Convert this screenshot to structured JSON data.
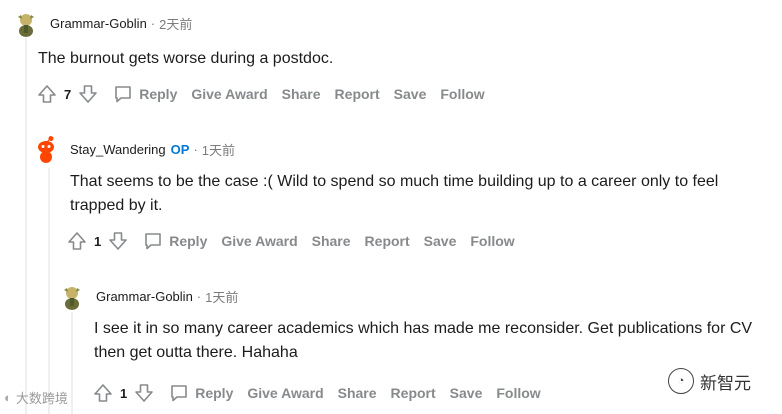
{
  "comments": [
    {
      "author": "Grammar-Goblin",
      "op_badge": "",
      "time": "2天前",
      "text": "The burnout gets worse during a postdoc.",
      "score": "7"
    },
    {
      "author": "Stay_Wandering",
      "op_badge": "OP",
      "time": "1天前",
      "text": "That seems to be the case :( Wild to spend so much time building up to a career only to feel trapped by it.",
      "score": "1"
    },
    {
      "author": "Grammar-Goblin",
      "op_badge": "",
      "time": "1天前",
      "text": "I see it in so many career academics which has made me reconsider. Get publications for CV then get outta there. Hahaha",
      "score": "1"
    }
  ],
  "actions": {
    "reply": "Reply",
    "give_award": "Give Award",
    "share": "Share",
    "report": "Report",
    "save": "Save",
    "follow": "Follow"
  },
  "separator": "·",
  "watermark": {
    "left": "大数跨境",
    "right": "新智元"
  },
  "colors": {
    "text": "#1c1c1c",
    "meta": "#7c7c7c",
    "action": "#878a8c",
    "op": "#0079d3",
    "thread_line": "#edeff1",
    "snoo": "#ff4500"
  }
}
